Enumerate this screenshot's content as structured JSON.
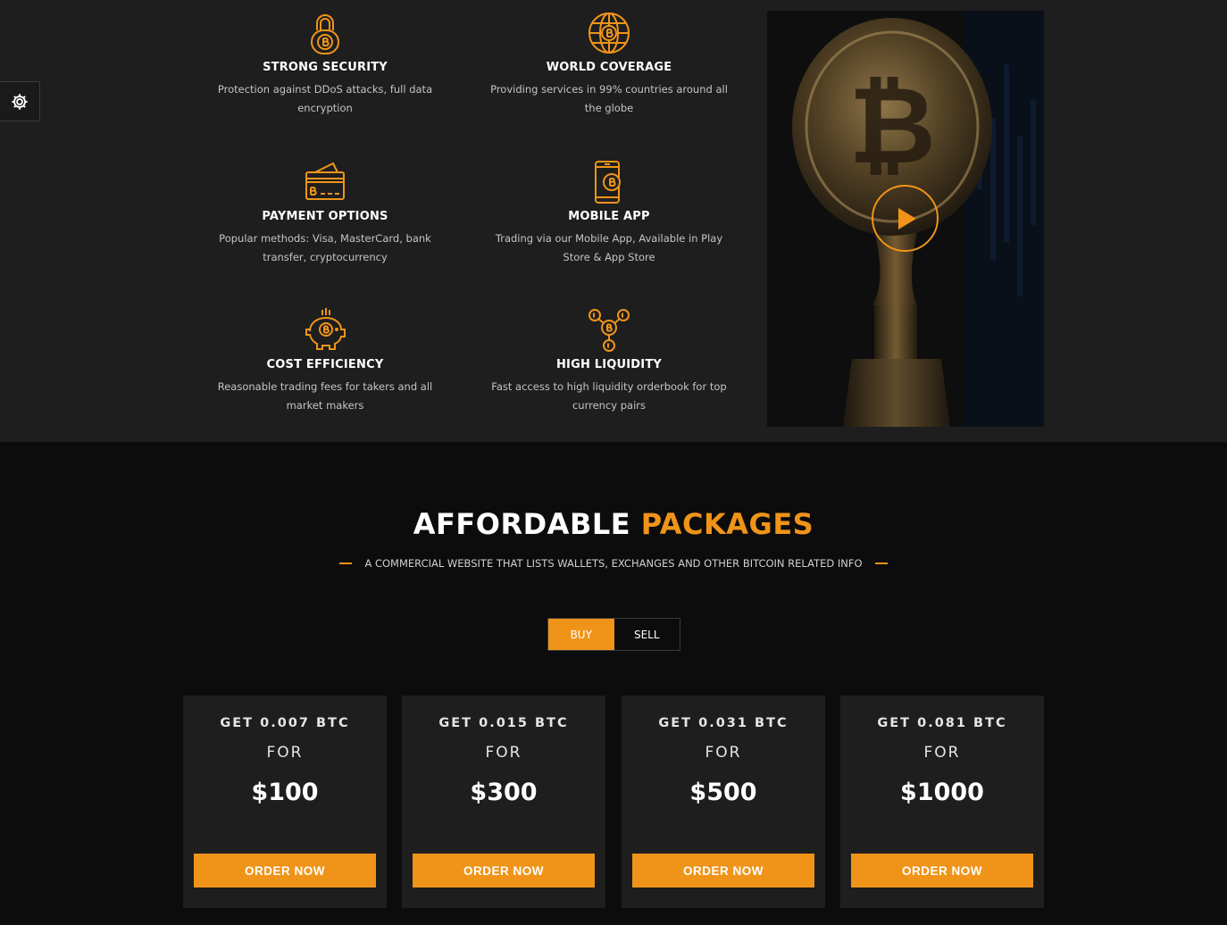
{
  "colors": {
    "accent": "#ef9419",
    "section_bg": "#1e1e1e",
    "page_bg": "#0c0c0c"
  },
  "settings": {
    "icon": "gear-icon"
  },
  "features": [
    {
      "icon": "lock-bitcoin-icon",
      "title": "STRONG SECURITY",
      "text": "Protection against DDoS attacks, full data encryption"
    },
    {
      "icon": "globe-bitcoin-icon",
      "title": "WORLD COVERAGE",
      "text": "Providing services in 99% countries around all the globe"
    },
    {
      "icon": "credit-card-bitcoin-icon",
      "title": "PAYMENT OPTIONS",
      "text": "Popular methods: Visa, MasterCard, bank transfer, cryptocurrency"
    },
    {
      "icon": "mobile-bitcoin-icon",
      "title": "MOBILE APP",
      "text": "Trading via our Mobile App, Available in Play Store & App Store"
    },
    {
      "icon": "piggy-bank-bitcoin-icon",
      "title": "COST EFFICIENCY",
      "text": "Reasonable trading fees for takers and all market makers"
    },
    {
      "icon": "bitcoin-network-icon",
      "title": "HIGH LIQUIDITY",
      "text": "Fast access to high liquidity orderbook for top currency pairs"
    }
  ],
  "video": {
    "icon": "play-icon"
  },
  "packages": {
    "title_main": "AFFORDABLE",
    "title_accent": "PACKAGES",
    "subtitle": "A COMMERCIAL WEBSITE THAT LISTS WALLETS, EXCHANGES AND OTHER BITCOIN RELATED INFO",
    "tabs": [
      {
        "label": "BUY",
        "active": true
      },
      {
        "label": "SELL",
        "active": false
      }
    ],
    "cards": [
      {
        "get": "GET 0.007 BTC",
        "for": "FOR",
        "price": "$100",
        "button": "ORDER NOW"
      },
      {
        "get": "GET 0.015 BTC",
        "for": "FOR",
        "price": "$300",
        "button": "ORDER NOW"
      },
      {
        "get": "GET 0.031 BTC",
        "for": "FOR",
        "price": "$500",
        "button": "ORDER NOW"
      },
      {
        "get": "GET 0.081 BTC",
        "for": "FOR",
        "price": "$1000",
        "button": "ORDER NOW"
      }
    ]
  }
}
